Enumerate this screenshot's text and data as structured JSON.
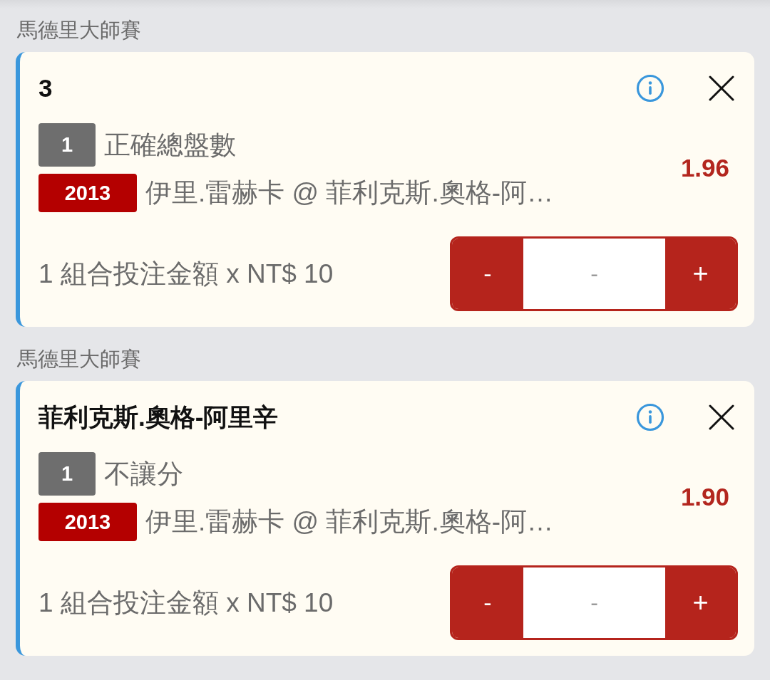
{
  "bet_slips": [
    {
      "competition": "馬德里大師賽",
      "title": "3",
      "selection_badge": "1",
      "market": "正確總盤數",
      "event_badge": "2013",
      "event": "伊里.雷赫卡 @ 菲利克斯.奧格-阿…",
      "odds": "1.96",
      "stake_summary": "1 組合投注金額 x NT$ 10",
      "stepper": {
        "decrement": "-",
        "placeholder": "-",
        "increment": "+"
      }
    },
    {
      "competition": "馬德里大師賽",
      "title": "菲利克斯.奧格-阿里辛",
      "selection_badge": "1",
      "market": "不讓分",
      "event_badge": "2013",
      "event": "伊里.雷赫卡 @ 菲利克斯.奧格-阿…",
      "odds": "1.90",
      "stake_summary": "1 組合投注金額 x NT$ 10",
      "stepper": {
        "decrement": "-",
        "placeholder": "-",
        "increment": "+"
      }
    }
  ]
}
